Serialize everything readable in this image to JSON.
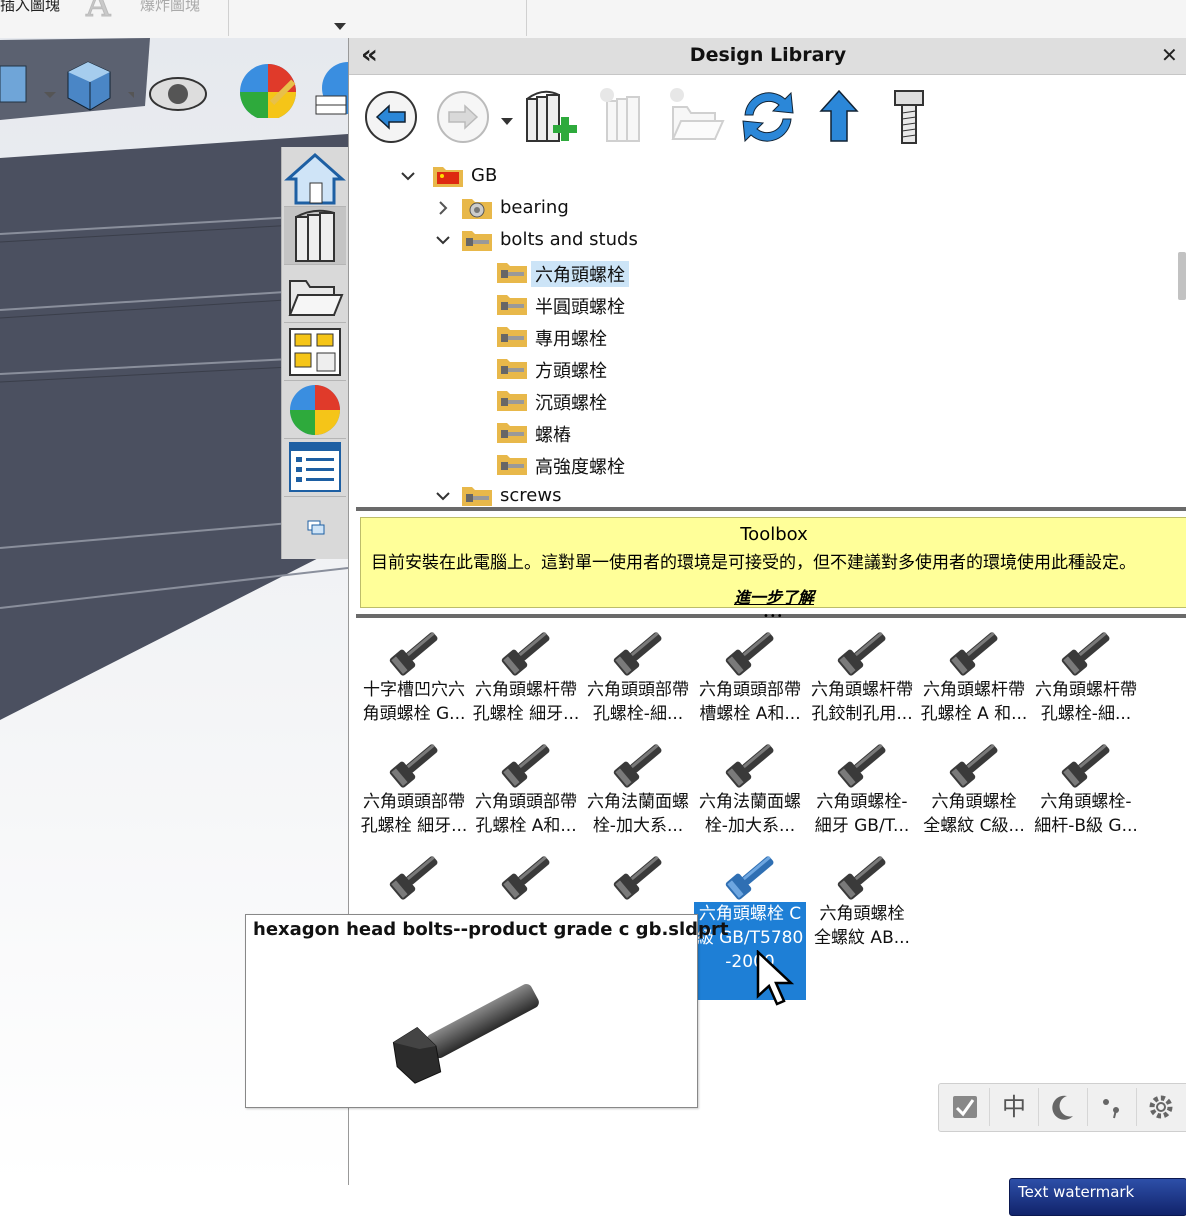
{
  "ribbon": {
    "item1_label": "插入圖塊",
    "item2_label": "爆炸圖塊"
  },
  "design_library": {
    "title": "Design Library",
    "collapse_glyph": "«",
    "pin_glyph": "✕",
    "toolbar": [
      {
        "name": "back-icon",
        "enabled": true
      },
      {
        "name": "forward-icon",
        "enabled": false
      },
      {
        "name": "add-to-library-icon",
        "enabled": true
      },
      {
        "name": "new-library-icon",
        "enabled": false
      },
      {
        "name": "new-folder-icon",
        "enabled": false
      },
      {
        "name": "refresh-icon",
        "enabled": true
      },
      {
        "name": "up-folder-icon",
        "enabled": true
      },
      {
        "name": "toolbox-bolt-icon",
        "enabled": true
      }
    ],
    "tree": {
      "root": "GB",
      "bearing": "bearing",
      "bolts": "bolts and studs",
      "children": [
        "六角頭螺栓",
        "半圓頭螺栓",
        "專用螺栓",
        "方頭螺栓",
        "沉頭螺栓",
        "螺樁",
        "高強度螺栓"
      ],
      "screws": "screws",
      "selected_index": 0
    },
    "toolbox_banner": {
      "title": "Toolbox",
      "message": "目前安裝在此電腦上。這對單一使用者的環境是可接受的，但不建議對多使用者的環境使用此種設定。",
      "link": "進一步了解"
    },
    "parts": [
      [
        "十字槽凹穴六",
        "角頭螺栓 G..."
      ],
      [
        "六角頭螺杆帶",
        "孔螺栓 細牙..."
      ],
      [
        "六角頭頭部帶",
        "孔螺栓-細..."
      ],
      [
        "六角頭頭部帶",
        "槽螺栓 A和..."
      ],
      [
        "六角頭螺杆帶",
        "孔鉸制孔用..."
      ],
      [
        "六角頭螺杆帶",
        "孔螺栓 A 和..."
      ],
      [
        "六角頭螺杆帶",
        "孔螺栓-細..."
      ],
      [
        "六角頭頭部帶",
        "孔螺栓 細牙..."
      ],
      [
        "六角頭頭部帶",
        "孔螺栓 A和..."
      ],
      [
        "六角法蘭面螺",
        "栓-加大系..."
      ],
      [
        "六角法蘭面螺",
        "栓-加大系..."
      ],
      [
        "六角頭螺栓-",
        "細牙 GB/T..."
      ],
      [
        "六角頭螺栓",
        "全螺紋 C級..."
      ],
      [
        "六角頭螺栓-",
        "細杆-B級 G..."
      ],
      [
        "",
        ""
      ],
      [
        "",
        ""
      ],
      [
        "",
        ""
      ],
      [
        "六角頭螺栓 C級 GB/T5780-2000",
        ""
      ],
      [
        "六角頭螺栓",
        "全螺紋 AB..."
      ]
    ],
    "selected_part_index": 17
  },
  "tooltip": {
    "title": "hexagon head bolts--product grade c gb.sldprt"
  },
  "ime_toolbar": {
    "mode_label": "中"
  },
  "watermark": {
    "text": "Text watermark"
  },
  "colors": {
    "selection_blue": "#1e7fd6",
    "banner_yellow": "#ffff99",
    "tree_selection": "#cce4f7"
  }
}
